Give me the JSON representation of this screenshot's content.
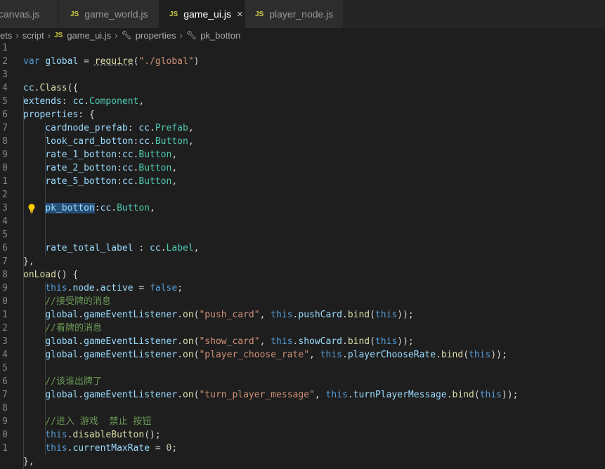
{
  "tabs": [
    {
      "label": "canvas.js",
      "icon": "js-file-icon",
      "active": false
    },
    {
      "label": "game_world.js",
      "icon": "js-file-icon",
      "active": false
    },
    {
      "label": "game_ui.js",
      "icon": "js-file-icon",
      "active": true
    },
    {
      "label": "player_node.js",
      "icon": "js-file-icon",
      "active": false
    }
  ],
  "tab_badge": "JS",
  "tab_close": "×",
  "breadcrumb": {
    "items": [
      "ets",
      "script",
      "game_ui.js",
      "properties",
      "pk_botton"
    ],
    "separator": "›"
  },
  "editor": {
    "line_numbers": [
      "1",
      "2",
      "3",
      "4",
      "5",
      "6",
      "7",
      "8",
      "9",
      "0",
      "1",
      "2",
      "3",
      "4",
      "5",
      "6",
      "7",
      "8",
      "9",
      "0",
      "1",
      "2",
      "3",
      "4",
      "5",
      "6",
      "7",
      "8",
      "9",
      "0",
      "1"
    ],
    "lightbulb_line": 13,
    "selected_text": "pk_botton",
    "lines": [
      "",
      "var global = require(\"./global\")",
      "",
      "cc.Class({",
      "    extends: cc.Component,",
      "    properties: {",
      "        cardnode_prefab: cc.Prefab,",
      "        look_card_botton:cc.Button,",
      "        rate_1_botton:cc.Button,",
      "        rate_2_botton:cc.Button,",
      "        rate_5_botton:cc.Button,",
      "",
      "        pk_botton:cc.Button,",
      "",
      "",
      "        rate_total_label : cc.Label,",
      "    },",
      "    onLoad() {",
      "        this.node.active = false;",
      "        //接受牌的消息",
      "        global.gameEventListener.on(\"push_card\", this.pushCard.bind(this));",
      "        //看牌的消息",
      "        global.gameEventListener.on(\"show_card\", this.showCard.bind(this));",
      "        global.gameEventListener.on(\"player_choose_rate\", this.playerChooseRate.bind(this));",
      "",
      "        //该谁出牌了",
      "        global.gameEventListener.on(\"turn_player_message\", this.turnPlayerMessage.bind(this));",
      "",
      "        //进入 游戏  禁止 按钮",
      "        this.disableButton();",
      "        this.currentMaxRate = 0;",
      "    },"
    ]
  },
  "colors": {
    "background": "#1e1e1e",
    "tab_bar": "#252526",
    "keyword": "#569cd6",
    "string": "#ce9178",
    "function": "#dcdcaa",
    "variable": "#9cdcfe",
    "class": "#4ec9b0",
    "number": "#b5cea8",
    "comment": "#6a9955",
    "selection": "#264f78",
    "lightbulb": "#ffcc00"
  }
}
